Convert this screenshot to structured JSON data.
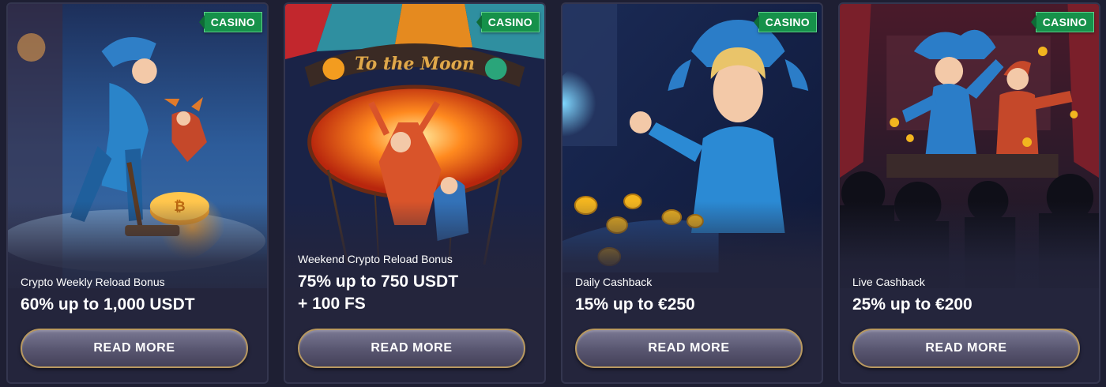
{
  "cards": [
    {
      "badge": "CASINO",
      "subtitle": "Crypto Weekly Reload Bonus",
      "offer_line1": "60% up to 1,000 USDT",
      "offer_line2": "",
      "button": "READ MORE",
      "art": "jester-sweeping-crypto-coins"
    },
    {
      "badge": "CASINO",
      "subtitle": "Weekend Crypto Reload Bonus",
      "offer_line1": "75% up to 750 USDT",
      "offer_line2": "+ 100 FS",
      "button": "READ MORE",
      "art": "to-the-moon-hot-air-balloon",
      "art_banner_text": "To the Moon"
    },
    {
      "badge": "CASINO",
      "subtitle": "Daily Cashback",
      "offer_line1": "15% up to €250",
      "offer_line2": "",
      "button": "READ MORE",
      "art": "jester-with-flying-gold-coins"
    },
    {
      "badge": "CASINO",
      "subtitle": "Live Cashback",
      "offer_line1": "25% up to €200",
      "offer_line2": "",
      "button": "READ MORE",
      "art": "jesters-on-stage-audience"
    }
  ],
  "colors": {
    "background": "#1e1f33",
    "card": "#24253c",
    "badge": "#16914a",
    "button_border": "#b99960",
    "button_fill": "#5a5872"
  }
}
